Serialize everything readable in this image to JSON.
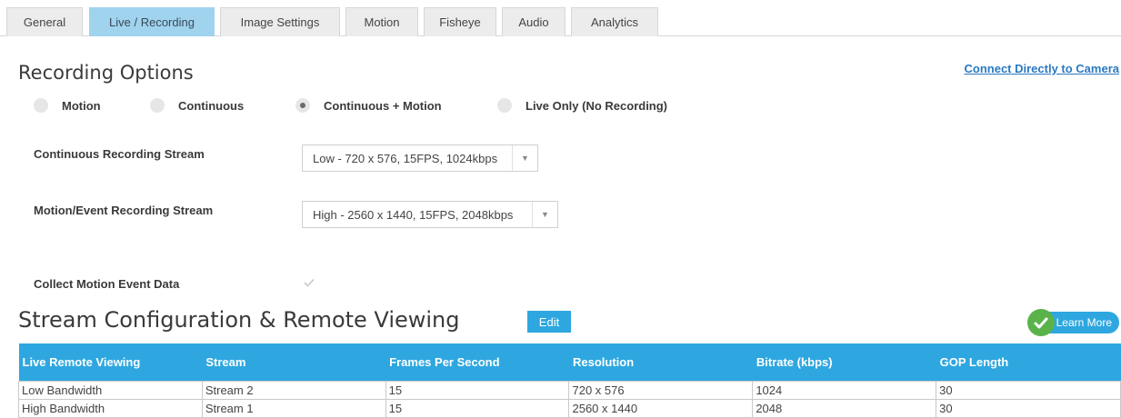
{
  "tabs": [
    {
      "label": "General"
    },
    {
      "label": "Live / Recording"
    },
    {
      "label": "Image Settings"
    },
    {
      "label": "Motion"
    },
    {
      "label": "Fisheye"
    },
    {
      "label": "Audio"
    },
    {
      "label": "Analytics"
    }
  ],
  "active_tab": "Live / Recording",
  "recording": {
    "title": "Recording Options",
    "connect_link": "Connect Directly to Camera",
    "modes": [
      {
        "label": "Motion",
        "selected": false
      },
      {
        "label": "Continuous",
        "selected": false
      },
      {
        "label": "Continuous + Motion",
        "selected": true
      },
      {
        "label": "Live Only (No Recording)",
        "selected": false
      }
    ],
    "continuous_stream": {
      "label": "Continuous Recording Stream",
      "value": "Low - 720 x 576, 15FPS, 1024kbps"
    },
    "motion_stream": {
      "label": "Motion/Event Recording Stream",
      "value": "High - 2560 x 1440, 15FPS, 2048kbps"
    },
    "collect_motion": {
      "label": "Collect Motion Event Data",
      "checked": true,
      "disabled": true
    }
  },
  "stream_config": {
    "title": "Stream Configuration & Remote Viewing",
    "edit_label": "Edit",
    "learn_more_label": "Learn More",
    "columns": [
      "Live Remote Viewing",
      "Stream",
      "Frames Per Second",
      "Resolution",
      "Bitrate (kbps)",
      "GOP Length"
    ],
    "rows": [
      [
        "Low Bandwidth",
        "Stream 2",
        "15",
        "720 x 576",
        "1024",
        "30"
      ],
      [
        "High Bandwidth",
        "Stream 1",
        "15",
        "2560 x 1440",
        "2048",
        "30"
      ]
    ]
  },
  "colors": {
    "accent": "#2ea7e0",
    "active_tab": "#9fd3ee",
    "link": "#2a79c1",
    "success": "#5ab34a"
  }
}
